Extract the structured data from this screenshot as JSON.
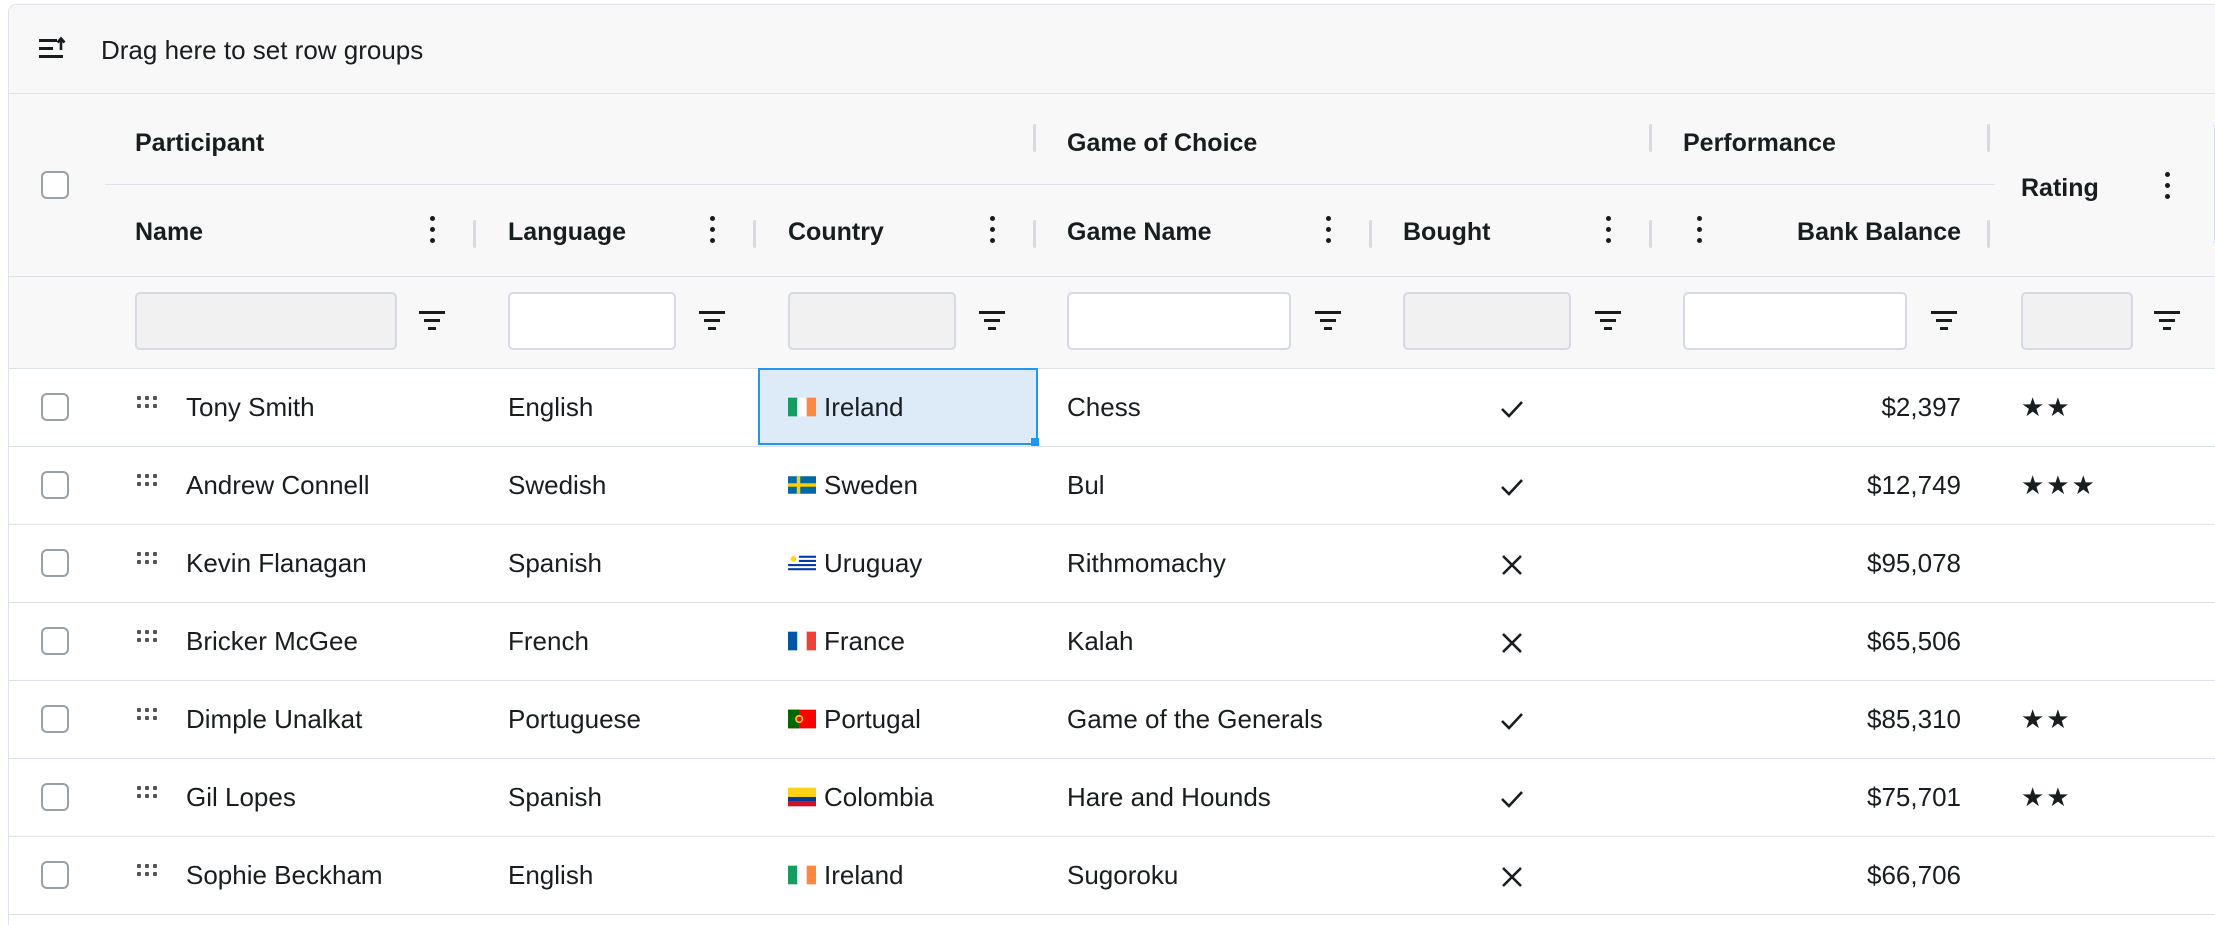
{
  "group_panel": {
    "icon": "row-group-icon",
    "label": "Drag here to set row groups"
  },
  "header": {
    "groups": {
      "participant": "Participant",
      "game_of_choice": "Game of Choice",
      "performance": "Performance"
    },
    "columns": {
      "name": "Name",
      "language": "Language",
      "country": "Country",
      "game_name": "Game Name",
      "bought": "Bought",
      "bank_balance": "Bank Balance",
      "rating": "Rating"
    }
  },
  "rows": [
    {
      "name": "Tony Smith",
      "language": "English",
      "country": "Ireland",
      "flag": "ireland",
      "game": "Chess",
      "bought": true,
      "balance": "$2,397",
      "rating": "★★"
    },
    {
      "name": "Andrew Connell",
      "language": "Swedish",
      "country": "Sweden",
      "flag": "sweden",
      "game": "Bul",
      "bought": true,
      "balance": "$12,749",
      "rating": "★★★"
    },
    {
      "name": "Kevin Flanagan",
      "language": "Spanish",
      "country": "Uruguay",
      "flag": "uruguay",
      "game": "Rithmomachy",
      "bought": false,
      "balance": "$95,078",
      "rating": ""
    },
    {
      "name": "Bricker McGee",
      "language": "French",
      "country": "France",
      "flag": "france",
      "game": "Kalah",
      "bought": false,
      "balance": "$65,506",
      "rating": ""
    },
    {
      "name": "Dimple Unalkat",
      "language": "Portuguese",
      "country": "Portugal",
      "flag": "portugal",
      "game": "Game of the Generals",
      "bought": true,
      "balance": "$85,310",
      "rating": "★★"
    },
    {
      "name": "Gil Lopes",
      "language": "Spanish",
      "country": "Colombia",
      "flag": "colombia",
      "game": "Hare and Hounds",
      "bought": true,
      "balance": "$75,701",
      "rating": "★★"
    },
    {
      "name": "Sophie Beckham",
      "language": "English",
      "country": "Ireland",
      "flag": "ireland",
      "game": "Sugoroku",
      "bought": false,
      "balance": "$66,706",
      "rating": ""
    }
  ],
  "selected_cell": {
    "row": 0,
    "column": "country"
  },
  "icons": {
    "bought_true": "check-icon",
    "bought_false": "cross-icon",
    "filter": "filter-icon",
    "column_menu": "kebab-menu-icon",
    "row_drag": "drag-handle-icon"
  },
  "colors": {
    "accent": "#2196f3",
    "selection": "#ddebf9",
    "header_bg": "#f8f8f8",
    "border": "#dde2eb"
  }
}
